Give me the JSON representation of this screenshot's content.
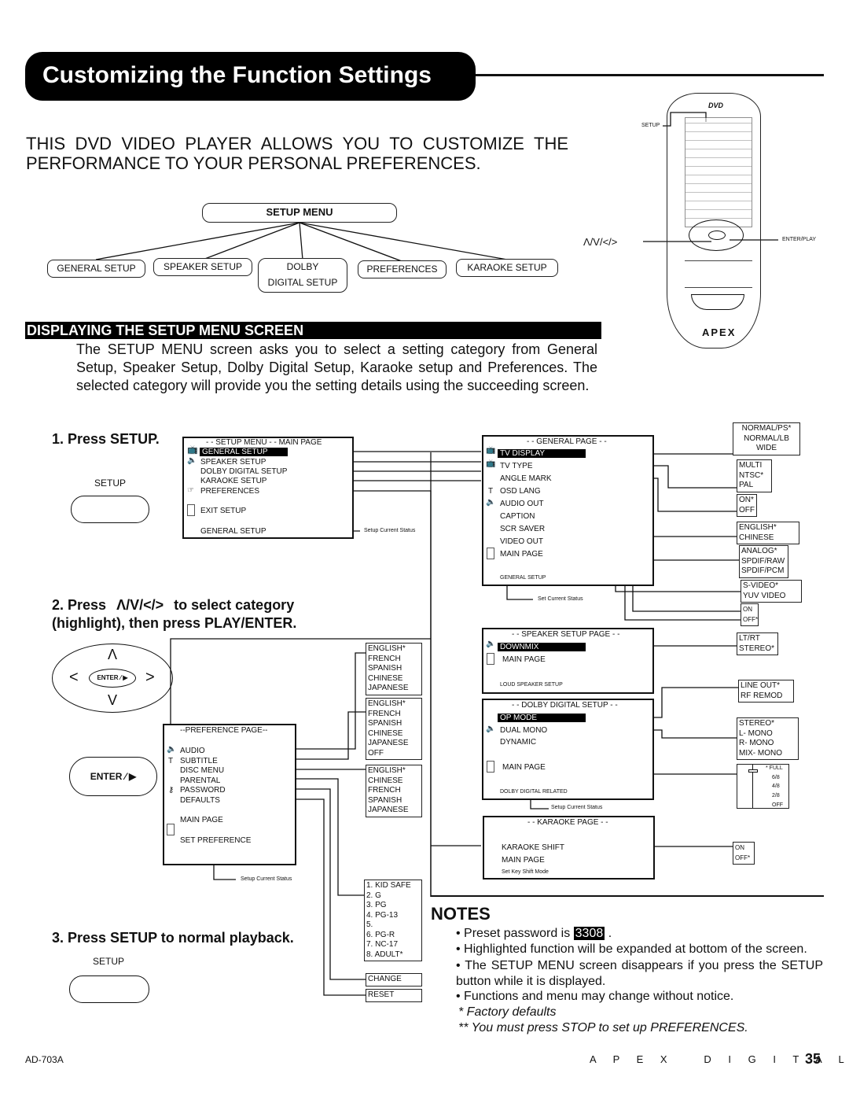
{
  "title": "Customizing the Function Settings",
  "intro": "THIS DVD VIDEO PLAYER ALLOWS YOU TO CUSTOMIZE THE PERFORMANCE TO YOUR PERSONAL PREFERENCES.",
  "tree": {
    "root": "SETUP MENU",
    "children": [
      "GENERAL SETUP",
      "SPEAKER SETUP",
      "DOLBY DIGITAL SETUP",
      "PREFERENCES",
      "KARAOKE SETUP"
    ],
    "dolby_l1": "DOLBY",
    "dolby_l2": "DIGITAL SETUP"
  },
  "section_heading": "DISPLAYING THE SETUP MENU SCREEN",
  "section_text": "The SETUP MENU screen asks you to select a setting category from General Setup, Speaker Setup, Dolby Digital Setup, Karaoke setup and Preferences. The selected category will provide you the setting details using the succeeding screen.",
  "steps": {
    "s1": "1. Press SETUP.",
    "setup_label": "SETUP",
    "s2a": "2. Press",
    "s2arrows": "Λ/V/</>",
    "s2b": "to select category",
    "s2c": "highlight), then press PLAY/ENTER.",
    "s2open": "(",
    "s3": "3. Press SETUP to normal playback.",
    "enter": "ENTER",
    "enter_small": "ENTER"
  },
  "main_menu": {
    "header": "- - SETUP MENU  - -  MAIN PAGE",
    "items": [
      "GENERAL SETUP",
      "SPEAKER SETUP",
      "DOLBY DIGITAL SETUP",
      "KARAOKE SETUP",
      "PREFERENCES",
      "EXIT SETUP"
    ],
    "status": "GENERAL SETUP",
    "status_note": "Setup Current Status"
  },
  "general_page": {
    "header": "- - GENERAL PAGE - -",
    "items": [
      "TV DISPLAY",
      "TV TYPE",
      "ANGLE MARK",
      "OSD LANG",
      "AUDIO OUT",
      "CAPTION",
      "SCR SAVER",
      "VIDEO OUT",
      "MAIN PAGE"
    ],
    "status": "GENERAL SETUP",
    "status_note": "Set Current Status",
    "options": {
      "tv_display": [
        "NORMAL/PS*",
        "NORMAL/LB",
        "WIDE"
      ],
      "tv_type": [
        "MULTI",
        "NTSC*",
        "PAL"
      ],
      "angle_mark": [
        "ON*",
        "OFF"
      ],
      "osd_lang": [
        "ENGLISH*",
        "CHINESE"
      ],
      "audio_out": [
        "ANALOG*",
        "SPDIF/RAW",
        "SPDIF/PCM"
      ],
      "video_out": [
        "S-VIDEO*",
        "YUV VIDEO"
      ],
      "scr_saver": [
        "ON",
        "OFF*"
      ]
    }
  },
  "speaker_page": {
    "header": "- - SPEAKER SETUP PAGE - -",
    "items": [
      "DOWNMIX",
      "MAIN PAGE"
    ],
    "status": "LOUD SPEAKER SETUP",
    "options": [
      "LT/RT",
      "STEREO*"
    ]
  },
  "dolby_page": {
    "header": "- - DOLBY DIGITAL SETUP - -",
    "items": [
      "OP MODE",
      "DUAL MONO",
      "DYNAMIC",
      "MAIN PAGE"
    ],
    "status": "DOLBY DIGITAL RELATED",
    "status_note": "Setup Current Status",
    "op_mode": [
      "LINE OUT*",
      "RF REMOD"
    ],
    "dual_mono": [
      "STEREO*",
      "L- MONO",
      "R- MONO",
      "MIX- MONO"
    ],
    "dynamic": [
      "* FULL",
      "6/8",
      "4/8",
      "2/8",
      "OFF"
    ],
    "dynamic_level": 1.0
  },
  "karaoke_page": {
    "header": "- - KARAOKE PAGE - -",
    "items": [
      "KARAOKE SHIFT",
      "MAIN PAGE"
    ],
    "status": "Set Key Shift Mode",
    "options": [
      "ON",
      "OFF*"
    ]
  },
  "pref_page": {
    "header": "--PREFERENCE PAGE--",
    "items": [
      "AUDIO",
      "SUBTITLE",
      "DISC MENU",
      "PARENTAL",
      "PASSWORD",
      "DEFAULTS",
      "MAIN PAGE",
      "SET PREFERENCE"
    ],
    "status_note": "Setup Current Status",
    "audio": [
      "ENGLISH*",
      "FRENCH",
      "SPANISH",
      "CHINESE",
      "JAPANESE"
    ],
    "subtitle": [
      "ENGLISH*",
      "FRENCH",
      "SPANISH",
      "CHINESE",
      "JAPANESE",
      "OFF"
    ],
    "disc_menu": [
      "ENGLISH*",
      "CHINESE",
      "FRENCH",
      "SPANISH",
      "JAPANESE"
    ],
    "parental": [
      "1. KID SAFE",
      "2. G",
      "3. PG",
      "4. PG-13",
      "5.",
      "6. PG-R",
      "7. NC-17",
      "8. ADULT*"
    ],
    "password": "CHANGE",
    "defaults": "RESET"
  },
  "remote": {
    "setup_label": "SETUP",
    "arrows_label": "Λ/V/</>",
    "enter_label": "ENTER/PLAY",
    "logo": "APEX",
    "dvd_logo": "DVD"
  },
  "notes": {
    "heading": "NOTES",
    "n1a": "• Preset password is ",
    "password": "3308",
    "n1b": " .",
    "n2": "• Highlighted function will be expanded at bottom of the screen.",
    "n3": "• The SETUP MENU screen disappears if you press the SETUP button while it is displayed.",
    "n4": "• Functions and menu may change without notice.",
    "f1": "* Factory defaults",
    "f2": "** You must press STOP to set up PREFERENCES."
  },
  "footer": {
    "model": "AD-703A",
    "brand": "A P E X   D I G I T A L",
    "page": "35"
  }
}
